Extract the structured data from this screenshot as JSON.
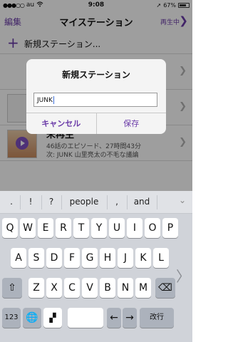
{
  "status": {
    "carrier": "au",
    "time": "9:08",
    "battery": "67%"
  },
  "nav": {
    "edit": "編集",
    "title": "マイステーション",
    "playing": "再生中"
  },
  "list": {
    "new_station": "新規ステーション...",
    "item3": {
      "title": "未再生",
      "subtitle": "46話のエピソード、27時間43分",
      "next": "次: JUNK 山里亮太の不毛な議論"
    }
  },
  "alert": {
    "title": "新規ステーション",
    "input_value": "JUNK",
    "cancel": "キャンセル",
    "save": "保存"
  },
  "keyboard": {
    "suggestions": [
      ".",
      "!",
      "?",
      "people",
      ",",
      "and"
    ],
    "rows": [
      [
        "Q",
        "W",
        "E",
        "R",
        "T",
        "Y",
        "U",
        "I",
        "O",
        "P"
      ],
      [
        "A",
        "S",
        "D",
        "F",
        "G",
        "H",
        "J",
        "K",
        "L"
      ],
      [
        "Z",
        "X",
        "C",
        "V",
        "B",
        "N",
        "M"
      ]
    ],
    "numbers_key": "123",
    "return_key": "改行"
  },
  "colors": {
    "accent": "#6a3aa8"
  }
}
